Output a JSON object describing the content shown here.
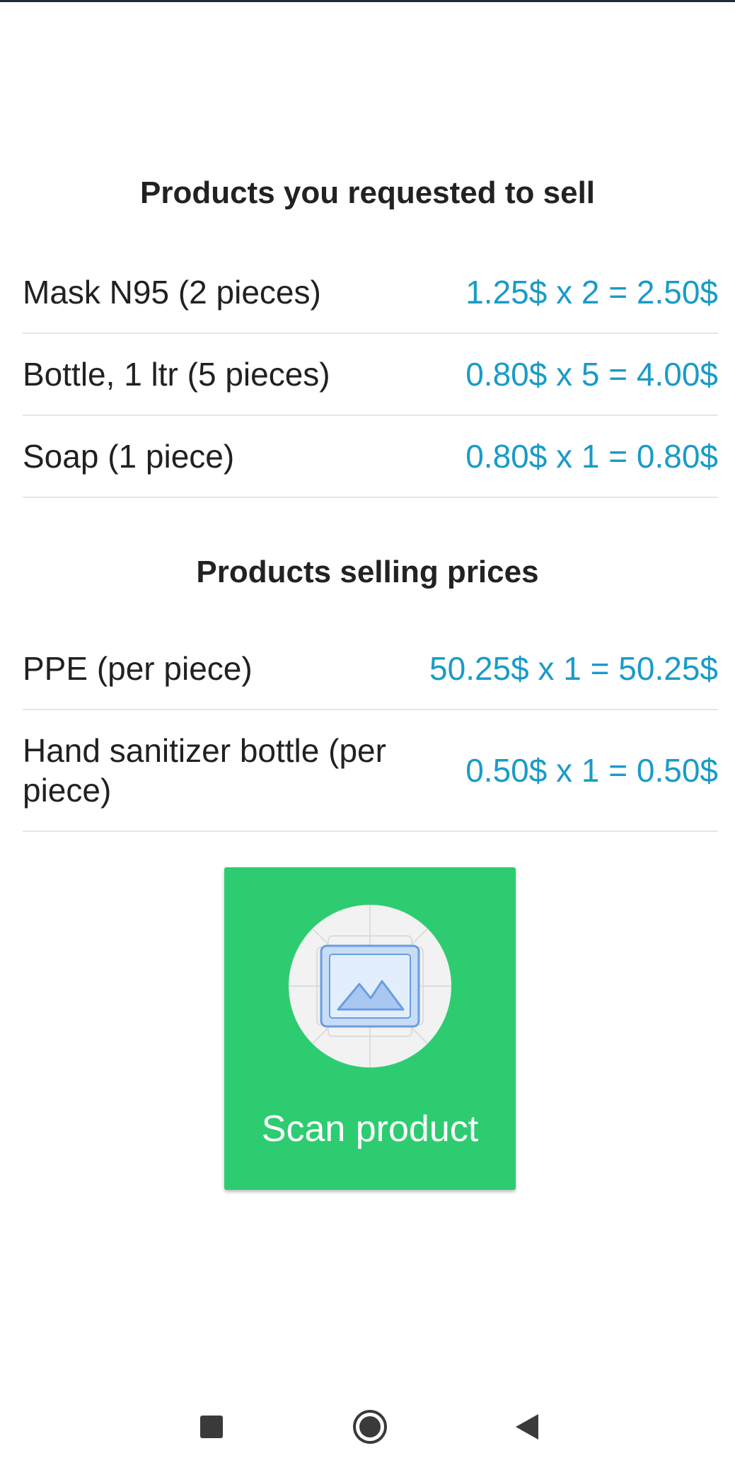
{
  "requested": {
    "title": "Products you requested to sell",
    "items": [
      {
        "name": "Mask N95 (2 pieces)",
        "price": "1.25$ x 2 = 2.50$"
      },
      {
        "name": "Bottle, 1 ltr (5 pieces)",
        "price": "0.80$ x 5 = 4.00$"
      },
      {
        "name": "Soap (1 piece)",
        "price": "0.80$ x 1 = 0.80$"
      }
    ]
  },
  "selling": {
    "title": "Products selling prices",
    "items": [
      {
        "name": "PPE (per piece)",
        "price": "50.25$ x 1 = 50.25$"
      },
      {
        "name": "Hand sanitizer bottle (per piece)",
        "price": "0.50$ x 1 = 0.50$"
      }
    ]
  },
  "scan": {
    "label": "Scan product",
    "icon": "image-placeholder-icon"
  },
  "navbar": {
    "recents_icon": "square-icon",
    "home_icon": "circle-icon",
    "back_icon": "triangle-back-icon"
  },
  "colors": {
    "accent_price": "#1a9bc7",
    "scan_button": "#2ecc71"
  }
}
